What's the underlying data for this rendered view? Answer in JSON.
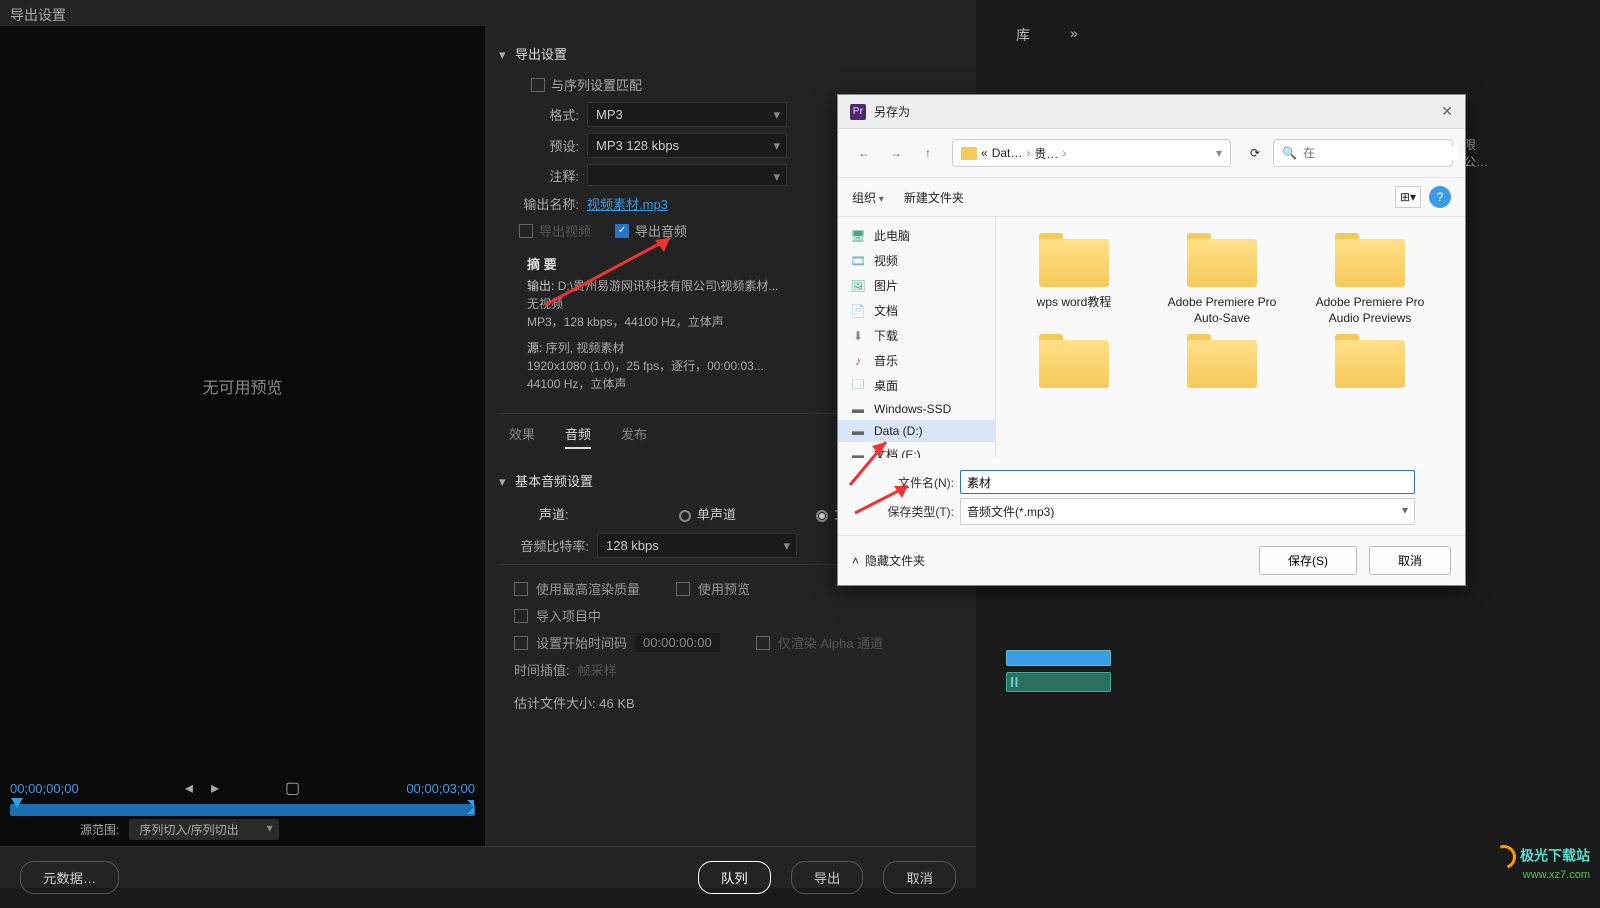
{
  "export": {
    "title": "导出设置",
    "section": "导出设置",
    "match_seq": "与序列设置匹配",
    "format_label": "格式:",
    "format_value": "MP3",
    "preset_label": "预设:",
    "preset_value": "MP3 128 kbps",
    "comment_label": "注释:",
    "output_name_label": "输出名称:",
    "output_name_value": "视频素材.mp3",
    "export_video": "导出视频",
    "export_audio": "导出音频",
    "summary": {
      "heading": "摘 要",
      "out_label": "输出:",
      "out_line1": "D:\\贵州易游网讯科技有限公司\\视频素材...",
      "out_line2": "无视频",
      "out_line3": "MP3，128 kbps，44100 Hz，立体声",
      "src_label": "源:",
      "src_line1": "序列, 视频素材",
      "src_line2": "1920x1080 (1.0)，25 fps，逐行，00:00:03...",
      "src_line3": "44100 Hz，立体声"
    },
    "tabs": {
      "effects": "效果",
      "audio": "音频",
      "publish": "发布"
    },
    "basic_audio": "基本音频设置",
    "channel_label": "声道:",
    "mono": "单声道",
    "stereo": "立体声",
    "bitrate_label": "音频比特率:",
    "bitrate_value": "128 kbps",
    "opts": {
      "max_quality": "使用最高渲染质量",
      "use_preview": "使用预览",
      "import_project": "导入项目中",
      "set_start_tc": "设置开始时间码",
      "tc_value": "00:00:00:00",
      "alpha_only": "仅渲染 Alpha 通道",
      "time_interp_label": "时间插值:",
      "time_interp_value": "帧采样",
      "est_label": "估计文件大小:",
      "est_value": "46 KB"
    },
    "btn_meta": "元数据…",
    "btn_queue": "队列",
    "btn_export": "导出",
    "btn_cancel": "取消",
    "preview_none": "无可用预览",
    "t0": "00;00;00;00",
    "t1": "00;00;03;00",
    "src_range_label": "源范围:",
    "src_range_value": "序列切入/序列切出"
  },
  "app": {
    "lib": "库",
    "more": "»"
  },
  "save": {
    "title": "另存为",
    "back": "←",
    "fwd": "→",
    "up": "↑",
    "crumb1": "Dat…",
    "crumb2": "贵…",
    "refresh": "⟳",
    "search_placeholder": "在",
    "search_hint": "限公…",
    "organize": "组织",
    "new_folder": "新建文件夹",
    "view_icon": "⊞",
    "help_icon": "?",
    "tree": {
      "pc": "此电脑",
      "video": "视频",
      "pictures": "图片",
      "docs": "文档",
      "downloads": "下载",
      "music": "音乐",
      "desktop": "桌面",
      "win": "Windows-SSD",
      "ddrive": "Data (D:)",
      "docsE": "文档 (E:)"
    },
    "folders": [
      "wps word教程",
      "Adobe Premiere Pro Auto-Save",
      "Adobe Premiere Pro Audio Previews"
    ],
    "fname_label": "文件名(N):",
    "fname_value": "素材",
    "ftype_label": "保存类型(T):",
    "ftype_value": "音频文件(*.mp3)",
    "hide_folders": "隐藏文件夹",
    "save_btn": "保存(S)",
    "cancel_btn": "取消"
  },
  "watermark": {
    "l1": "极光下载站",
    "l2": "www.xz7.com"
  }
}
